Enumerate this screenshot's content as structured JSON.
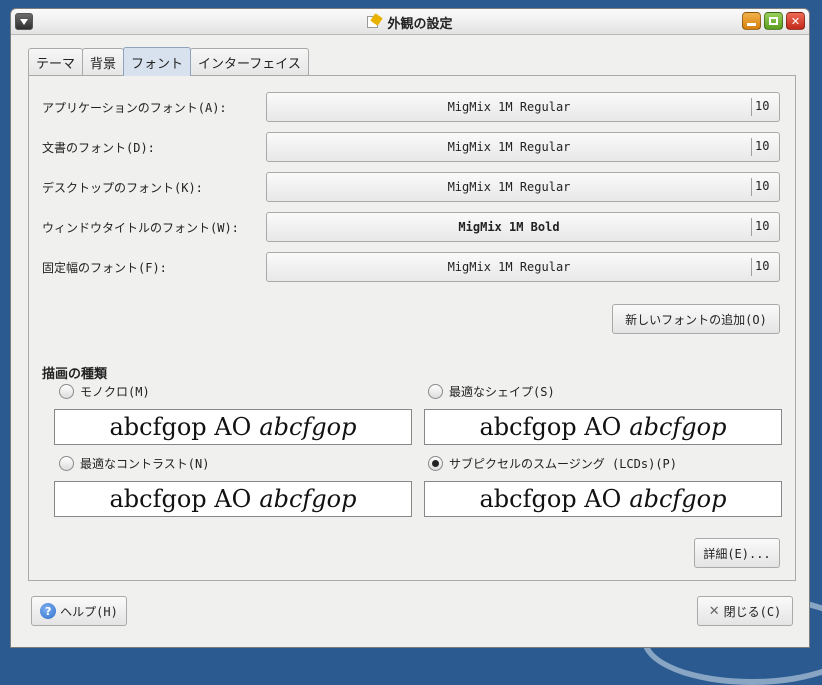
{
  "window": {
    "title": "外観の設定"
  },
  "tabs": [
    {
      "label": "テーマ",
      "active": false
    },
    {
      "label": "背景",
      "active": false
    },
    {
      "label": "フォント",
      "active": true
    },
    {
      "label": "インターフェイス",
      "active": false
    }
  ],
  "fonts": [
    {
      "label": "アプリケーションのフォント(A):",
      "name": "MigMix 1M Regular",
      "size": "10"
    },
    {
      "label": "文書のフォント(D):",
      "name": "MigMix 1M Regular",
      "size": "10"
    },
    {
      "label": "デスクトップのフォント(K):",
      "name": "MigMix 1M Regular",
      "size": "10"
    },
    {
      "label": "ウィンドウタイトルのフォント(W):",
      "name": "MigMix 1M Bold",
      "size": "10"
    },
    {
      "label": "固定幅のフォント(F):",
      "name": "MigMix 1M Regular",
      "size": "10"
    }
  ],
  "add_font_button": "新しいフォントの追加(O)",
  "rendering": {
    "title": "描画の種類",
    "options": [
      {
        "label": "モノクロ(M)",
        "checked": false,
        "preview_regular": "abcfgop AO",
        "preview_italic": "abcfgop"
      },
      {
        "label": "最適なシェイプ(S)",
        "checked": false,
        "preview_regular": "abcfgop AO",
        "preview_italic": "abcfgop"
      },
      {
        "label": "最適なコントラスト(N)",
        "checked": false,
        "preview_regular": "abcfgop AO",
        "preview_italic": "abcfgop"
      },
      {
        "label": "サブピクセルのスムージング (LCDs)(P)",
        "checked": true,
        "preview_regular": "abcfgop AO",
        "preview_italic": "abcfgop"
      }
    ]
  },
  "details_button": "詳細(E)...",
  "help_button": "ヘルプ(H)",
  "close_button": "閉じる(C)",
  "colors": {
    "desktop": "#2a5a8f",
    "window_bg": "#f0f0ee",
    "active_tab": "#d8e2ee"
  }
}
